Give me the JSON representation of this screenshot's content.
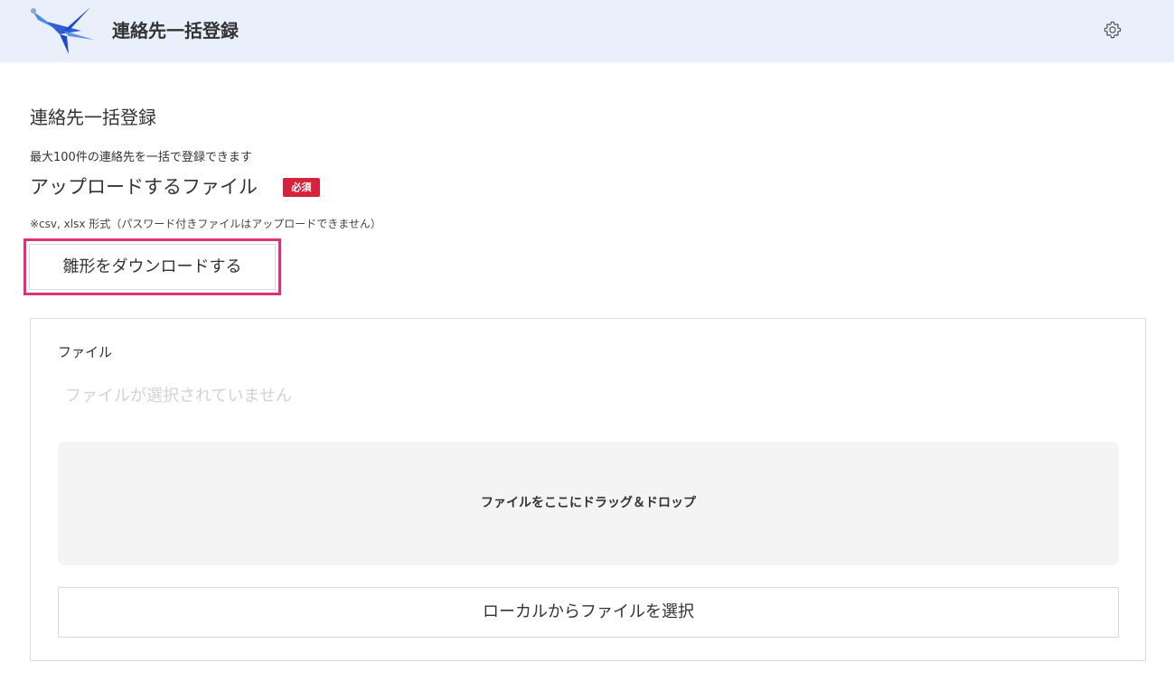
{
  "header": {
    "app_title": "連絡先一括登録",
    "logo_icon": "swallow-logo-icon",
    "settings_icon": "gear-icon"
  },
  "main": {
    "page_title": "連絡先一括登録",
    "description": "最大100件の連絡先を一括で登録できます",
    "upload_label": "アップロードするファイル",
    "required_badge": "必須",
    "format_note": "※csv, xlsx 形式（パスワード付きファイルはアップロードできません）",
    "download_template_label": "雛形をダウンロードする"
  },
  "file_panel": {
    "label": "ファイル",
    "placeholder": "ファイルが選択されていません",
    "dropzone_text": "ファイルをここにドラッグ＆ドロップ",
    "select_button_label": "ローカルからファイルを選択"
  },
  "colors": {
    "header_bg": "#e9f0fb",
    "badge_red": "#d6223a",
    "highlight_pink": "#e0307a",
    "logo_blue": "#2f5fd6"
  }
}
